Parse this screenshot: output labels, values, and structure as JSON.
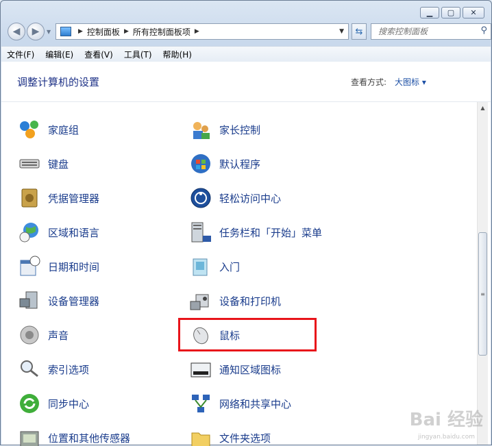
{
  "address": {
    "segments": [
      "控制面板",
      "所有控制面板项"
    ]
  },
  "search": {
    "placeholder": "搜索控制面板"
  },
  "menu": [
    "文件(F)",
    "编辑(E)",
    "查看(V)",
    "工具(T)",
    "帮助(H)"
  ],
  "header": {
    "title": "调整计算机的设置",
    "view_by_label": "查看方式:",
    "view_by_value": "大图标"
  },
  "items_left": [
    "家庭组",
    "键盘",
    "凭据管理器",
    "区域和语言",
    "日期和时间",
    "设备管理器",
    "声音",
    "索引选项",
    "同步中心",
    "位置和其他传感器"
  ],
  "items_right": [
    "家长控制",
    "默认程序",
    "轻松访问中心",
    "任务栏和「开始」菜单",
    "入门",
    "设备和打印机",
    "鼠标",
    "通知区域图标",
    "网络和共享中心",
    "文件夹选项"
  ],
  "watermark": {
    "main": "Bai 经验",
    "sub": "jingyan.baidu.com"
  }
}
